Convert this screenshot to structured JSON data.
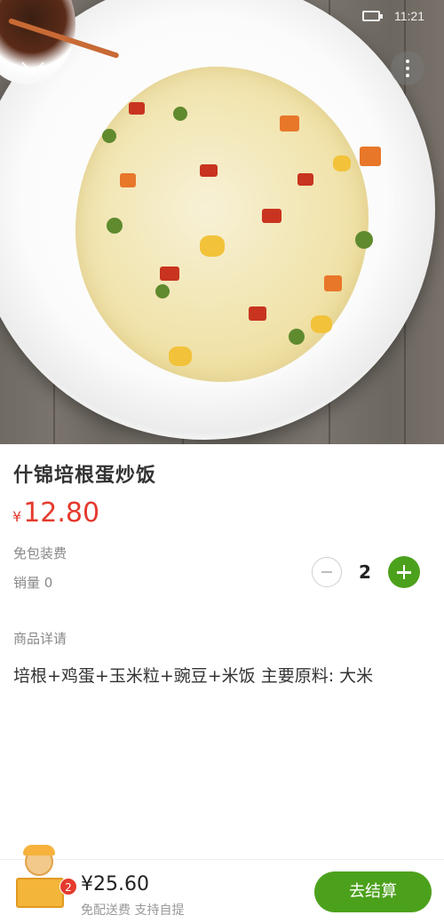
{
  "status_bar": {
    "time": "11:21"
  },
  "product": {
    "name": "什锦培根蛋炒饭",
    "currency": "¥",
    "price": "12.80",
    "packing_fee": "免包装费",
    "sales": "销量 0",
    "quantity": "2"
  },
  "details": {
    "title": "商品详请",
    "description": "培根+鸡蛋+玉米粒+豌豆+米饭 主要原料: 大米"
  },
  "cart": {
    "badge_count": "2",
    "total": "¥25.60",
    "delivery_note": "免配送费  支持自提",
    "checkout_label": "去结算"
  },
  "colors": {
    "accent_green": "#4ca11c",
    "price_red": "#e53a2e"
  },
  "icons": [
    "back-chevron-icon",
    "more-vertical-icon",
    "battery-icon",
    "minus-icon",
    "plus-icon",
    "cart-mascot-icon"
  ]
}
